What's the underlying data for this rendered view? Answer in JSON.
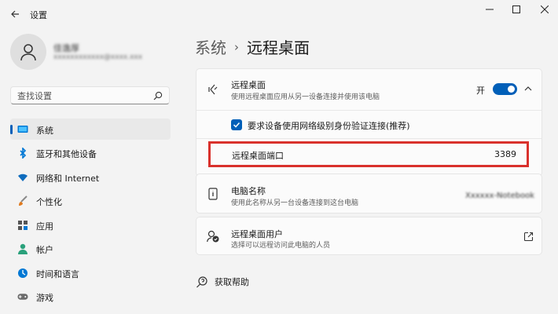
{
  "window": {
    "app_title": "设置",
    "back_icon": "arrow-left-icon",
    "controls": [
      "minimize-icon",
      "maximize-icon",
      "close-icon"
    ]
  },
  "user": {
    "name": "佳逸厚",
    "email": "xxxxxxxxxxxx@xxxx.xxx"
  },
  "search": {
    "placeholder": "查找设置",
    "value": ""
  },
  "sidebar": {
    "items": [
      {
        "label": "系统",
        "icon": "monitor-icon",
        "selected": true,
        "color": "#0078d4"
      },
      {
        "label": "蓝牙和其他设备",
        "icon": "bluetooth-icon",
        "selected": false,
        "color": "#0078d4"
      },
      {
        "label": "网络和 Internet",
        "icon": "wifi-icon",
        "selected": false,
        "color": "#0f6cbd"
      },
      {
        "label": "个性化",
        "icon": "brush-icon",
        "selected": false,
        "color": "#e07a1f"
      },
      {
        "label": "应用",
        "icon": "apps-icon",
        "selected": false,
        "color": "#555555"
      },
      {
        "label": "帐户",
        "icon": "person-icon",
        "selected": false,
        "color": "#2aa17b"
      },
      {
        "label": "时间和语言",
        "icon": "globe-clock-icon",
        "selected": false,
        "color": "#0078d4"
      },
      {
        "label": "游戏",
        "icon": "gamepad-icon",
        "selected": false,
        "color": "#6b6b6b"
      }
    ]
  },
  "main": {
    "breadcrumb_parent": "系统",
    "breadcrumb_separator": "›",
    "page_title": "远程桌面",
    "remote_desktop": {
      "title": "远程桌面",
      "description": "使用远程桌面应用从另一设备连接并使用该电脑",
      "toggle_label": "开",
      "toggle_on": true,
      "nla_label": "要求设备使用网络级别身份验证连接(推荐)",
      "nla_checked": true,
      "port_label": "远程桌面端口",
      "port_value": "3389"
    },
    "pc_name": {
      "title": "电脑名称",
      "description": "使用此名称从另一台设备连接到这台电脑",
      "value": "Xxxxxx-Notebook"
    },
    "users": {
      "title": "远程桌面用户",
      "description": "选择可以远程访问此电脑的人员"
    },
    "help_label": "获取帮助"
  },
  "colors": {
    "accent": "#005fb8",
    "highlight_border": "#d9312c"
  }
}
